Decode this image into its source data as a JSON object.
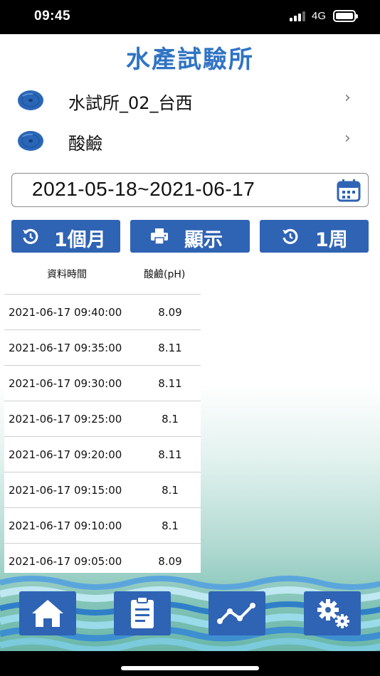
{
  "status_bar": {
    "time": "09:45",
    "network": "4G"
  },
  "app_title": "水產試驗所",
  "menu": [
    {
      "label": "水試所_02_台西",
      "icon": "disc-icon"
    },
    {
      "label": "酸鹼",
      "icon": "disc-icon"
    }
  ],
  "date_range": {
    "value": "2021-05-18~2021-06-17",
    "icon": "calendar-icon"
  },
  "buttons": {
    "month": {
      "label": "1個月",
      "icon": "refresh-icon"
    },
    "display": {
      "label": "顯示",
      "icon": "printer-icon"
    },
    "week": {
      "label": "1周",
      "icon": "refresh-icon"
    }
  },
  "table": {
    "headers": [
      "資料時間",
      "酸鹼(pH)"
    ],
    "rows": [
      [
        "2021-06-17 09:40:00",
        "8.09"
      ],
      [
        "2021-06-17 09:35:00",
        "8.11"
      ],
      [
        "2021-06-17 09:30:00",
        "8.11"
      ],
      [
        "2021-06-17 09:25:00",
        "8.1"
      ],
      [
        "2021-06-17 09:20:00",
        "8.11"
      ],
      [
        "2021-06-17 09:15:00",
        "8.1"
      ],
      [
        "2021-06-17 09:10:00",
        "8.1"
      ],
      [
        "2021-06-17 09:05:00",
        "8.09"
      ]
    ]
  },
  "bottom_nav": [
    {
      "icon": "home-icon"
    },
    {
      "icon": "clipboard-icon"
    },
    {
      "icon": "chart-line-icon"
    },
    {
      "icon": "gears-icon"
    }
  ],
  "colors": {
    "accent": "#2f63b4",
    "title": "#2f73c4",
    "teal": "#5fb0a3"
  }
}
